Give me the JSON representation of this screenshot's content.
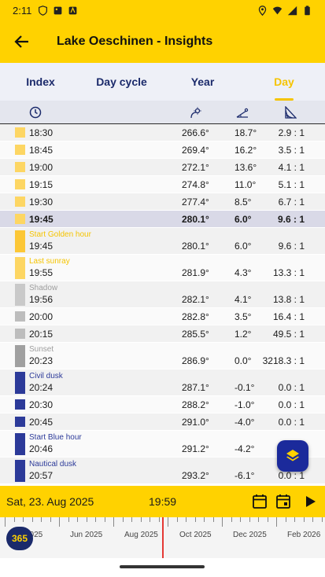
{
  "status_bar": {
    "time": "2:11"
  },
  "app_bar": {
    "title": "Lake Oeschinen - Insights"
  },
  "tabs": [
    {
      "label": "Index"
    },
    {
      "label": "Day cycle"
    },
    {
      "label": "Year"
    },
    {
      "label": "Day",
      "selected": true
    }
  ],
  "columns": [
    "time",
    "sun-azimuth",
    "sun-elevation",
    "shadow-ratio"
  ],
  "rows": [
    {
      "label": "",
      "time": "18:30",
      "azimuth": "266.6°",
      "elevation": "18.7°",
      "ratio": "2.9 : 1",
      "color": "#fdd663"
    },
    {
      "label": "",
      "time": "18:45",
      "azimuth": "269.4°",
      "elevation": "16.2°",
      "ratio": "3.5 : 1",
      "color": "#fdd663"
    },
    {
      "label": "",
      "time": "19:00",
      "azimuth": "272.1°",
      "elevation": "13.6°",
      "ratio": "4.1 : 1",
      "color": "#fdd663"
    },
    {
      "label": "",
      "time": "19:15",
      "azimuth": "274.8°",
      "elevation": "11.0°",
      "ratio": "5.1 : 1",
      "color": "#fdd663"
    },
    {
      "label": "",
      "time": "19:30",
      "azimuth": "277.4°",
      "elevation": "8.5°",
      "ratio": "6.7 : 1",
      "color": "#fdd663"
    },
    {
      "label": "",
      "time": "19:45",
      "azimuth": "280.1°",
      "elevation": "6.0°",
      "ratio": "9.6 : 1",
      "color": "#fdd663",
      "highlighted": true
    },
    {
      "label": "Start Golden hour",
      "time": "19:45",
      "azimuth": "280.1°",
      "elevation": "6.0°",
      "ratio": "9.6 : 1",
      "color": "#fcc736",
      "label_color": "#f5c400"
    },
    {
      "label": "Last sunray",
      "time": "19:55",
      "azimuth": "281.9°",
      "elevation": "4.3°",
      "ratio": "13.3 : 1",
      "color": "#fdd663",
      "label_color": "#f5c400"
    },
    {
      "label": "Shadow",
      "time": "19:56",
      "azimuth": "282.1°",
      "elevation": "4.1°",
      "ratio": "13.8 : 1",
      "color": "#c9c9c9",
      "label_color": "#9e9e9e"
    },
    {
      "label": "",
      "time": "20:00",
      "azimuth": "282.8°",
      "elevation": "3.5°",
      "ratio": "16.4 : 1",
      "color": "#bdbdbd"
    },
    {
      "label": "",
      "time": "20:15",
      "azimuth": "285.5°",
      "elevation": "1.2°",
      "ratio": "49.5 : 1",
      "color": "#bdbdbd"
    },
    {
      "label": "Sunset",
      "time": "20:23",
      "azimuth": "286.9°",
      "elevation": "0.0°",
      "ratio": "3218.3 : 1",
      "color": "#a0a0a0",
      "label_color": "#9e9e9e"
    },
    {
      "label": "Civil dusk",
      "time": "20:24",
      "azimuth": "287.1°",
      "elevation": "-0.1°",
      "ratio": "0.0 : 1",
      "color": "#2c3a99",
      "label_color": "#2c3a99"
    },
    {
      "label": "",
      "time": "20:30",
      "azimuth": "288.2°",
      "elevation": "-1.0°",
      "ratio": "0.0 : 1",
      "color": "#2c3a99"
    },
    {
      "label": "",
      "time": "20:45",
      "azimuth": "291.0°",
      "elevation": "-4.0°",
      "ratio": "0.0 : 1",
      "color": "#2c3a99"
    },
    {
      "label": "Start Blue hour",
      "time": "20:46",
      "azimuth": "291.2°",
      "elevation": "-4.2°",
      "ratio": "",
      "color": "#2c3a99",
      "label_color": "#2c3a99"
    },
    {
      "label": "Nautical dusk",
      "time": "20:57",
      "azimuth": "293.2°",
      "elevation": "-6.1°",
      "ratio": "0.0 : 1",
      "color": "#2c3a99",
      "label_color": "#2c3a99"
    }
  ],
  "bottom_bar": {
    "date": "Sat, 23. Aug 2025",
    "time": "19:59"
  },
  "timeline": {
    "badge": "365",
    "labels": [
      "2025",
      "Jun 2025",
      "Aug 2025",
      "Oct 2025",
      "Dec 2025",
      "Feb 2026"
    ]
  },
  "colors": {
    "accent": "#ffd200",
    "brand_blue": "#1b2a6b",
    "cursor": "#e53935"
  }
}
